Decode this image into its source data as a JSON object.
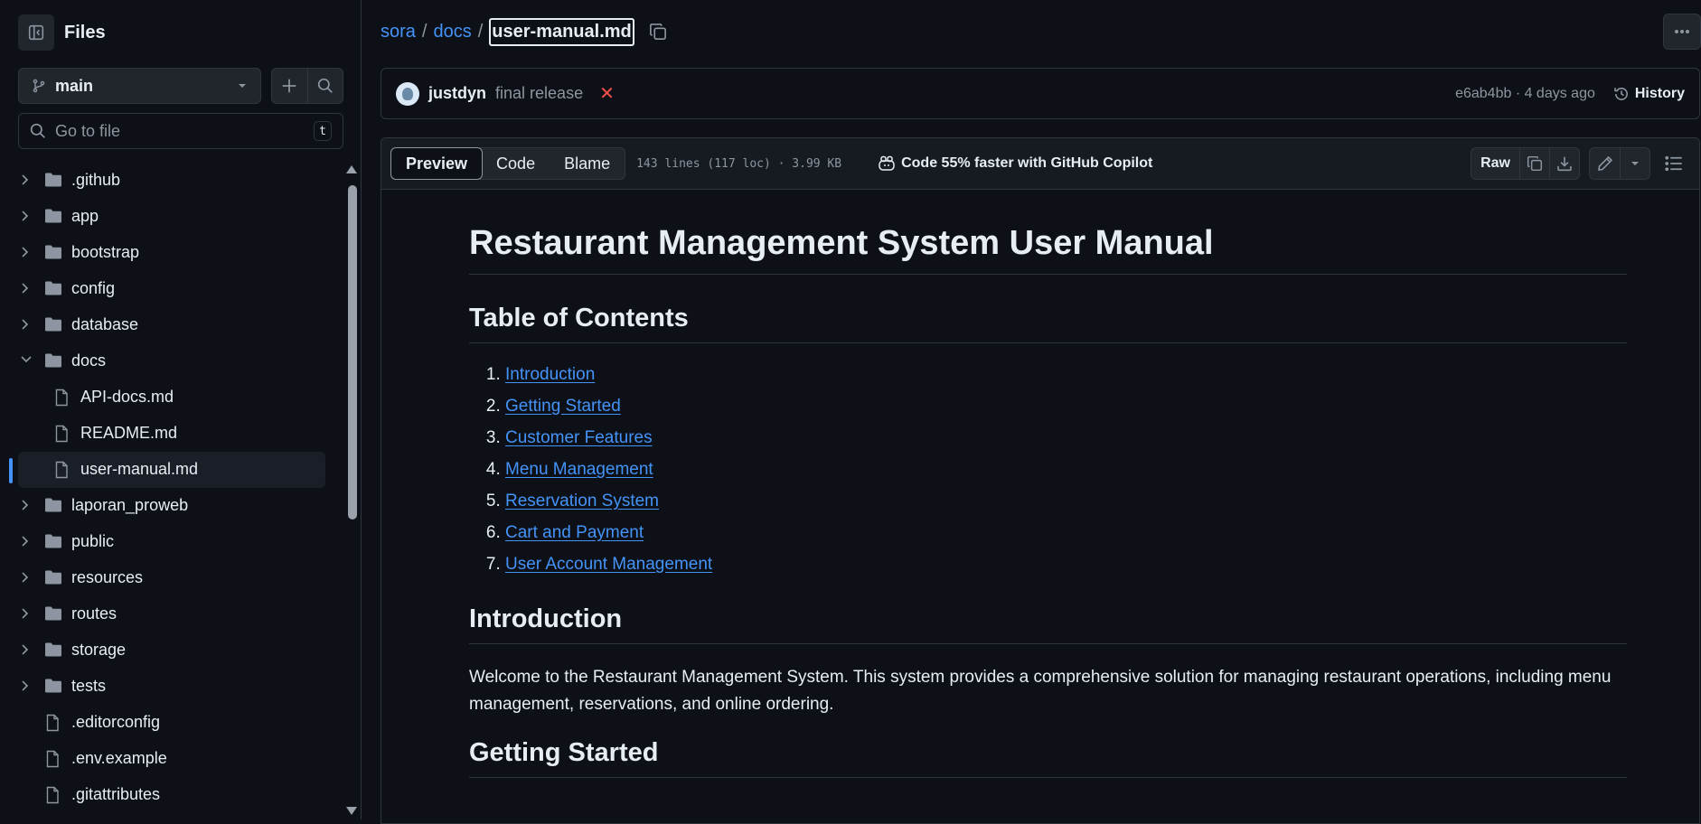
{
  "sidebar": {
    "title": "Files",
    "branch": "main",
    "goto_placeholder": "Go to file",
    "goto_shortcut": "t",
    "items": [
      {
        "name": ".github",
        "type": "folder"
      },
      {
        "name": "app",
        "type": "folder"
      },
      {
        "name": "bootstrap",
        "type": "folder"
      },
      {
        "name": "config",
        "type": "folder"
      },
      {
        "name": "database",
        "type": "folder"
      },
      {
        "name": "docs",
        "type": "folder",
        "expanded": true
      },
      {
        "name": "API-docs.md",
        "type": "file"
      },
      {
        "name": "README.md",
        "type": "file"
      },
      {
        "name": "user-manual.md",
        "type": "file",
        "selected": true
      },
      {
        "name": "laporan_proweb",
        "type": "folder"
      },
      {
        "name": "public",
        "type": "folder"
      },
      {
        "name": "resources",
        "type": "folder"
      },
      {
        "name": "routes",
        "type": "folder"
      },
      {
        "name": "storage",
        "type": "folder"
      },
      {
        "name": "tests",
        "type": "folder"
      },
      {
        "name": ".editorconfig",
        "type": "file"
      },
      {
        "name": ".env.example",
        "type": "file"
      },
      {
        "name": ".gitattributes",
        "type": "file"
      }
    ]
  },
  "breadcrumb": {
    "repo": "sora",
    "folder": "docs",
    "file": "user-manual.md",
    "sep": "/"
  },
  "commit": {
    "author": "justdyn",
    "message": "final release",
    "status_icon": "x-icon",
    "meta": "e6ab4bb · 4 days ago",
    "history_label": "History"
  },
  "file_header": {
    "tabs": [
      "Preview",
      "Code",
      "Blame"
    ],
    "active_tab": "Preview",
    "stats": "143 lines (117 loc) · 3.99 KB",
    "copilot": "Code 55% faster with GitHub Copilot",
    "raw_label": "Raw"
  },
  "doc": {
    "title": "Restaurant Management System User Manual",
    "toc_heading": "Table of Contents",
    "toc": [
      "Introduction",
      "Getting Started",
      "Customer Features",
      "Menu Management",
      "Reservation System",
      "Cart and Payment",
      "User Account Management"
    ],
    "intro_heading": "Introduction",
    "intro_text": "Welcome to the Restaurant Management System. This system provides a comprehensive solution for managing restaurant operations, including menu management, reservations, and online ordering.",
    "getting_started_heading": "Getting Started"
  },
  "colors": {
    "background": "#0d1117",
    "link": "#4493f8",
    "border": "#30363d",
    "muted": "#8d96a0",
    "danger": "#f85149"
  }
}
